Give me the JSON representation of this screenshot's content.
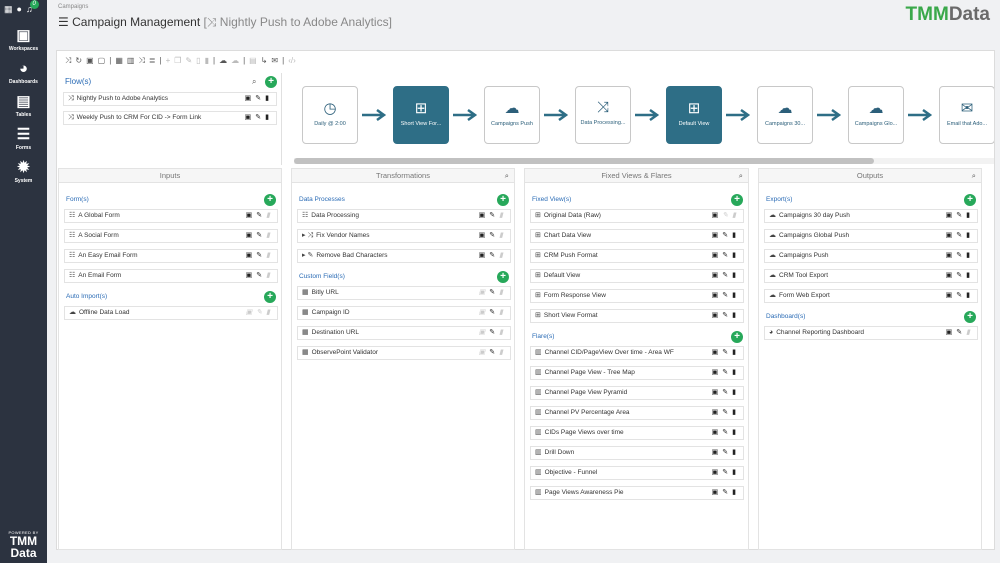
{
  "sidebar": {
    "nav": [
      {
        "label": "Workspaces",
        "icon": "briefcase-icon"
      },
      {
        "label": "Dashboards",
        "icon": "dashboard-icon"
      },
      {
        "label": "Tables",
        "icon": "table-icon"
      },
      {
        "label": "Forms",
        "icon": "list-icon"
      },
      {
        "label": "System",
        "icon": "gear-icon"
      }
    ],
    "powered_by": "POWERED BY",
    "brand": "TMM",
    "brand2": "Data",
    "notification_count": "0"
  },
  "header": {
    "breadcrumb": "Campaigns",
    "title": "Campaign Management",
    "subtitle": "[⤨ Nightly Push to Adobe Analytics]",
    "logo_a": "TMM",
    "logo_b": "Data"
  },
  "flows": {
    "title": "Flow(s)",
    "items": [
      "Nightly Push to Adobe Analytics",
      "Weekly Push to CRM For CID -> Form Link"
    ]
  },
  "nodes": [
    {
      "label": "Daily @ 2:00",
      "icon": "clock-icon",
      "dark": false
    },
    {
      "label": "Short View For...",
      "icon": "hierarchy-icon",
      "dark": true
    },
    {
      "label": "Campaigns Push",
      "icon": "cloud-download-icon",
      "dark": false
    },
    {
      "label": "Data Processing...",
      "icon": "shuffle-icon",
      "dark": false
    },
    {
      "label": "Default View",
      "icon": "hierarchy-icon",
      "dark": true
    },
    {
      "label": "Campaigns 30...",
      "icon": "cloud-download-icon",
      "dark": false
    },
    {
      "label": "Campaigns Glo...",
      "icon": "cloud-download-icon",
      "dark": false
    },
    {
      "label": "Email that Ado...",
      "icon": "envelope-icon",
      "dark": false
    }
  ],
  "inputs": {
    "title": "Inputs",
    "forms_label": "Form(s)",
    "forms": [
      "A Global Form",
      "A Social Form",
      "An Easy Email Form",
      "An Email Form"
    ],
    "auto_label": "Auto Import(s)",
    "autos": [
      "Offline Data Load"
    ]
  },
  "transforms": {
    "title": "Transformations",
    "dp_label": "Data Processes",
    "dps": [
      "Data Processing",
      "Fix Vendor Names",
      "Remove Bad Characters"
    ],
    "cf_label": "Custom Field(s)",
    "cfs": [
      "Bitly URL",
      "Campaign ID",
      "Destination URL",
      "ObservePoint Validator"
    ]
  },
  "fixed": {
    "title": "Fixed Views & Flares",
    "views_label": "Fixed View(s)",
    "views": [
      "Original Data (Raw)",
      "Chart Data View",
      "CRM Push Format",
      "Default View",
      "Form Response View",
      "Short View Format"
    ],
    "flares_label": "Flare(s)",
    "flares": [
      "Channel CID/PageView Over time - Area WF",
      "Channel Page View - Tree Map",
      "Channel Page View Pyramid",
      "Channel PV Percentage Area",
      "CIDs Page Views over time",
      "Drill Down",
      "Objective - Funnel",
      "Page Views Awareness Pie"
    ]
  },
  "outputs": {
    "title": "Outputs",
    "exports_label": "Export(s)",
    "exports": [
      "Campaigns 30 day Push",
      "Campaigns Global Push",
      "Campaigns Push",
      "CRM Tool Export",
      "Form Web Export"
    ],
    "dash_label": "Dashboard(s)",
    "dashboards": [
      "Channel Reporting Dashboard"
    ]
  },
  "colors": {
    "sidebar": "#2c3340",
    "accent_green": "#27a85a",
    "node_dark": "#2e6e86",
    "link_blue": "#2a6bb5"
  }
}
